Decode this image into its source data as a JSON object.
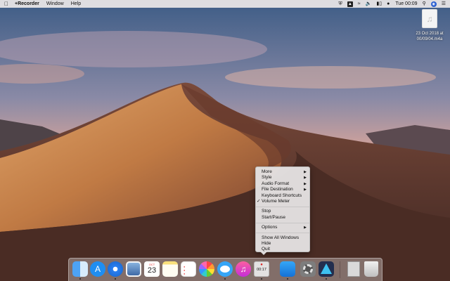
{
  "menubar": {
    "apple_icon": "apple-logo-icon",
    "app_name": "+Recorder",
    "menus": [
      "Window",
      "Help"
    ],
    "status_icons": [
      "shield-icon",
      "airplay-icon",
      "wifi-icon",
      "volume-icon",
      "battery-icon",
      "user-icon"
    ],
    "clock": "Tue 00:09",
    "end_icons": [
      "search-icon",
      "siri-icon",
      "list-icon"
    ]
  },
  "desktop": {
    "file": {
      "icon": "music-note-icon",
      "label_line1": "23 Oct 2018 at",
      "label_line2": "00/09/04.m4a"
    }
  },
  "context_menu": {
    "items": [
      {
        "label": "More",
        "submenu": true
      },
      {
        "label": "Style",
        "submenu": true
      },
      {
        "label": "Audio Format",
        "submenu": true
      },
      {
        "label": "File Destination",
        "submenu": true
      },
      {
        "label": "Keyboard Shortcuts",
        "submenu": false
      },
      {
        "label": "Volume Meter",
        "submenu": false,
        "checked": true
      },
      {
        "label": "Stop",
        "submenu": false
      },
      {
        "label": "Start/Pause",
        "submenu": false
      },
      {
        "label": "Options",
        "submenu": true
      },
      {
        "label": "Show All Windows",
        "submenu": false
      },
      {
        "label": "Hide",
        "submenu": false
      },
      {
        "label": "Quit",
        "submenu": false
      }
    ],
    "check_glyph": "✓",
    "arrow_glyph": "▶"
  },
  "dock": {
    "calendar_month": "OCT",
    "calendar_day": "23",
    "appstore_glyph": "A",
    "itunes_glyph": "♫",
    "recorder_time": "00:17",
    "recorder_dot": "●"
  },
  "colors": {
    "sky_top": "#3b5f8a",
    "dune_light": "#c98a4e",
    "dune_dark": "#5a3426"
  }
}
